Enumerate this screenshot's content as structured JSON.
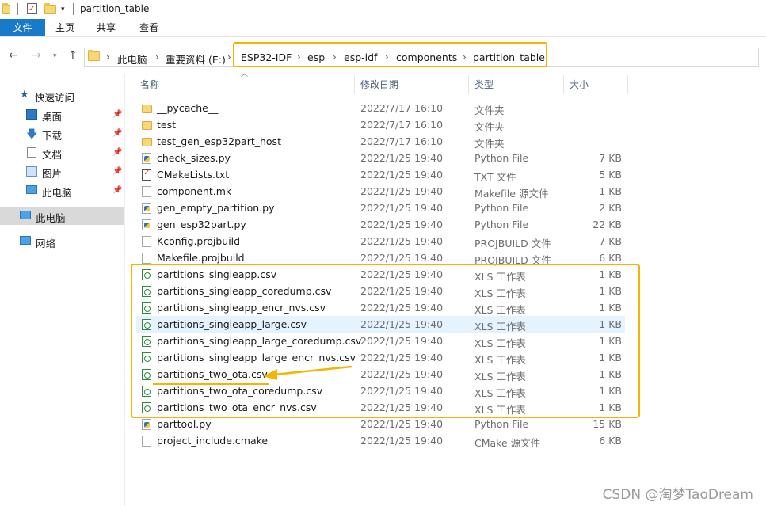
{
  "window": {
    "title": "partition_table"
  },
  "ribbon": {
    "tabs": [
      "文件",
      "主页",
      "共享",
      "查看"
    ]
  },
  "address": {
    "crumbs": [
      "此电脑",
      "重要资料 (E:)",
      "ESP32-IDF",
      "esp",
      "esp-idf",
      "components",
      "partition_table"
    ]
  },
  "sidebar": {
    "quick_access": "快速访问",
    "items": [
      "桌面",
      "下载",
      "文档",
      "图片",
      "此电脑"
    ],
    "this_pc": "此电脑",
    "network": "网络"
  },
  "columns": {
    "name": "名称",
    "date": "修改日期",
    "type": "类型",
    "size": "大小"
  },
  "files": [
    {
      "name": "__pycache__",
      "date": "2022/7/17 16:10",
      "type": "文件夹",
      "size": "",
      "icon": "folder-icon"
    },
    {
      "name": "test",
      "date": "2022/7/17 16:10",
      "type": "文件夹",
      "size": "",
      "icon": "folder-icon"
    },
    {
      "name": "test_gen_esp32part_host",
      "date": "2022/7/17 16:10",
      "type": "文件夹",
      "size": "",
      "icon": "folder-icon"
    },
    {
      "name": "check_sizes.py",
      "date": "2022/1/25 19:40",
      "type": "Python File",
      "size": "7 KB",
      "icon": "python-file-icon"
    },
    {
      "name": "CMakeLists.txt",
      "date": "2022/1/25 19:40",
      "type": "TXT 文件",
      "size": "5 KB",
      "icon": "text-file-icon"
    },
    {
      "name": "component.mk",
      "date": "2022/1/25 19:40",
      "type": "Makefile 源文件",
      "size": "1 KB",
      "icon": "document-icon"
    },
    {
      "name": "gen_empty_partition.py",
      "date": "2022/1/25 19:40",
      "type": "Python File",
      "size": "2 KB",
      "icon": "python-file-icon"
    },
    {
      "name": "gen_esp32part.py",
      "date": "2022/1/25 19:40",
      "type": "Python File",
      "size": "22 KB",
      "icon": "python-file-icon"
    },
    {
      "name": "Kconfig.projbuild",
      "date": "2022/1/25 19:40",
      "type": "PROJBUILD 文件",
      "size": "7 KB",
      "icon": "document-icon"
    },
    {
      "name": "Makefile.projbuild",
      "date": "2022/1/25 19:40",
      "type": "PROJBUILD 文件",
      "size": "6 KB",
      "icon": "document-icon"
    },
    {
      "name": "partitions_singleapp.csv",
      "date": "2022/1/25 19:40",
      "type": "XLS 工作表",
      "size": "1 KB",
      "icon": "csv-file-icon"
    },
    {
      "name": "partitions_singleapp_coredump.csv",
      "date": "2022/1/25 19:40",
      "type": "XLS 工作表",
      "size": "1 KB",
      "icon": "csv-file-icon"
    },
    {
      "name": "partitions_singleapp_encr_nvs.csv",
      "date": "2022/1/25 19:40",
      "type": "XLS 工作表",
      "size": "1 KB",
      "icon": "csv-file-icon"
    },
    {
      "name": "partitions_singleapp_large.csv",
      "date": "2022/1/25 19:40",
      "type": "XLS 工作表",
      "size": "1 KB",
      "icon": "csv-file-icon"
    },
    {
      "name": "partitions_singleapp_large_coredump.csv",
      "date": "2022/1/25 19:40",
      "type": "XLS 工作表",
      "size": "1 KB",
      "icon": "csv-file-icon"
    },
    {
      "name": "partitions_singleapp_large_encr_nvs.csv",
      "date": "2022/1/25 19:40",
      "type": "XLS 工作表",
      "size": "1 KB",
      "icon": "csv-file-icon"
    },
    {
      "name": "partitions_two_ota.csv",
      "date": "2022/1/25 19:40",
      "type": "XLS 工作表",
      "size": "1 KB",
      "icon": "csv-file-icon"
    },
    {
      "name": "partitions_two_ota_coredump.csv",
      "date": "2022/1/25 19:40",
      "type": "XLS 工作表",
      "size": "1 KB",
      "icon": "csv-file-icon"
    },
    {
      "name": "partitions_two_ota_encr_nvs.csv",
      "date": "2022/1/25 19:40",
      "type": "XLS 工作表",
      "size": "1 KB",
      "icon": "csv-file-icon"
    },
    {
      "name": "parttool.py",
      "date": "2022/1/25 19:40",
      "type": "Python File",
      "size": "15 KB",
      "icon": "python-file-icon"
    },
    {
      "name": "project_include.cmake",
      "date": "2022/1/25 19:40",
      "type": "CMake 源文件",
      "size": "6 KB",
      "icon": "document-icon"
    }
  ],
  "watermark": "CSDN @淘梦TaoDream",
  "colors": {
    "highlight": "#f5b400",
    "file_tab": "#1979ca",
    "row_hover": "#e5f3ff"
  }
}
